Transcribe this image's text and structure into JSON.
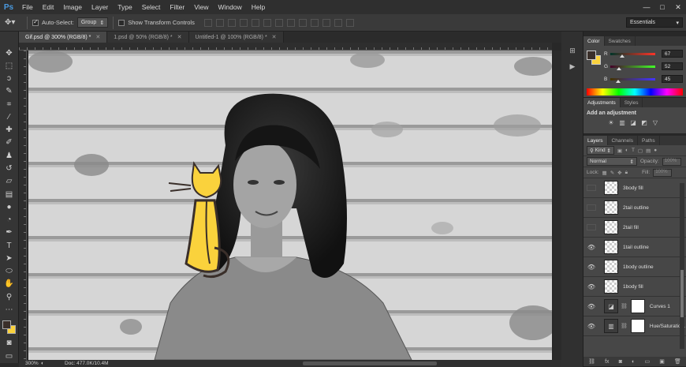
{
  "app": {
    "logo": "Ps"
  },
  "menu": [
    "File",
    "Edit",
    "Image",
    "Layer",
    "Type",
    "Select",
    "Filter",
    "View",
    "Window",
    "Help"
  ],
  "window_controls": [
    "—",
    "□",
    "✕"
  ],
  "options": {
    "auto_select_label": "Auto-Select:",
    "auto_select_checked": true,
    "auto_select_value": "Group",
    "show_transform_label": "Show Transform Controls",
    "workspace": "Essentials"
  },
  "tabs": [
    {
      "label": "Gif.psd @ 300% (RGB/8) *",
      "active": true
    },
    {
      "label": "1.psd @ 50% (RGB/8) *",
      "active": false
    },
    {
      "label": "Untitled-1 @ 100% (RGB/8) *",
      "active": false
    }
  ],
  "status": {
    "zoom": "300%",
    "doc": "Doc: 477.0K/10.4M"
  },
  "color_panel": {
    "tabs": [
      "Color",
      "Swatches"
    ],
    "rows": [
      {
        "letter": "R",
        "value": "67",
        "fraction": 0.26,
        "gradient": [
          "#003428",
          "#ff3428"
        ]
      },
      {
        "letter": "G",
        "value": "52",
        "fraction": 0.2,
        "gradient": [
          "#430028",
          "#43ff28"
        ]
      },
      {
        "letter": "B",
        "value": "45",
        "fraction": 0.18,
        "gradient": [
          "#433400",
          "#4334ff"
        ]
      }
    ],
    "foreground": "#3a2f2a",
    "background": "#fad23c"
  },
  "adjustments_panel": {
    "tabs": [
      "Adjustments",
      "Styles"
    ],
    "title": "Add an adjustment"
  },
  "layers_panel": {
    "tabs": [
      "Layers",
      "Channels",
      "Paths"
    ],
    "kind_label": "Kind",
    "blend_mode": "Normal",
    "opacity_label": "Opacity:",
    "opacity_value": "100%",
    "lock_label": "Lock:",
    "fill_label": "Fill:",
    "fill_value": "100%",
    "layers": [
      {
        "name": "3body fill",
        "visible": false,
        "type": "pixel"
      },
      {
        "name": "2tail outline",
        "visible": false,
        "type": "pixel"
      },
      {
        "name": "2tail fill",
        "visible": false,
        "type": "pixel"
      },
      {
        "name": "1tail outline",
        "visible": true,
        "type": "pixel"
      },
      {
        "name": "1body outline",
        "visible": true,
        "type": "pixel"
      },
      {
        "name": "1body fill",
        "visible": true,
        "type": "pixel"
      },
      {
        "name": "Curves 1",
        "visible": true,
        "type": "adjustment"
      },
      {
        "name": "Hue/Saturatio...",
        "visible": true,
        "type": "adjustment"
      }
    ]
  }
}
